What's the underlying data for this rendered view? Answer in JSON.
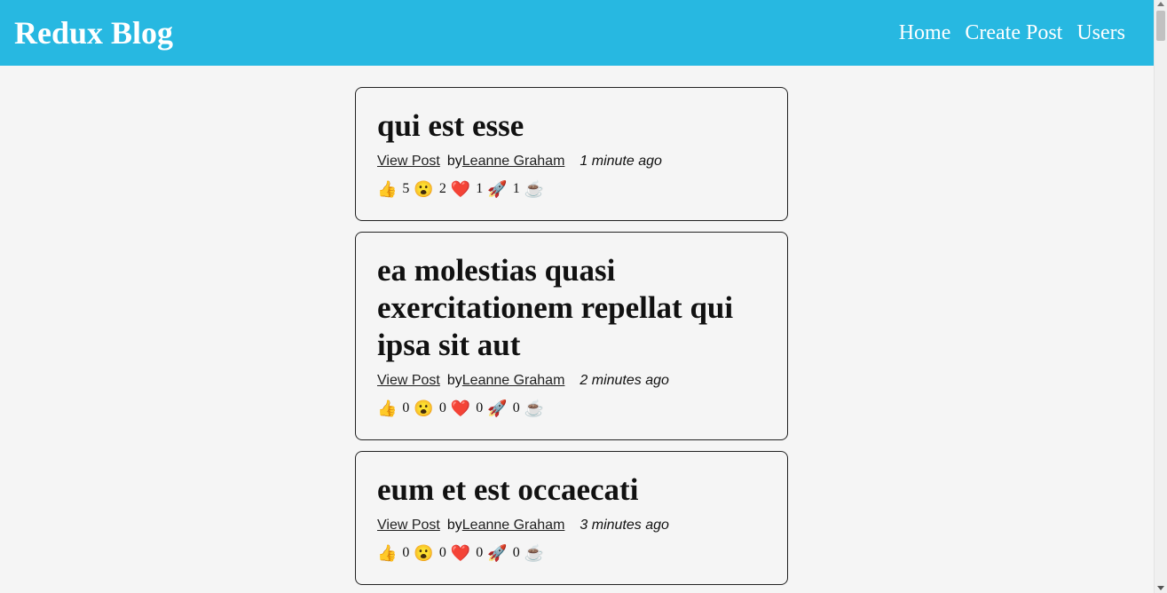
{
  "header": {
    "title": "Redux Blog",
    "nav": [
      "Home",
      "Create Post",
      "Users"
    ]
  },
  "posts": [
    {
      "title": "qui est esse",
      "view_link": "View Post",
      "by_prefix": "by",
      "author": "Leanne Graham",
      "time": "1 minute ago",
      "reactions": {
        "thumbs_up": "5",
        "wow": "2",
        "heart": "1",
        "rocket": "1",
        "coffee": ""
      }
    },
    {
      "title": "ea molestias quasi exercitationem repellat qui ipsa sit aut",
      "view_link": "View Post",
      "by_prefix": "by",
      "author": "Leanne Graham",
      "time": "2 minutes ago",
      "reactions": {
        "thumbs_up": "0",
        "wow": "0",
        "heart": "0",
        "rocket": "0",
        "coffee": ""
      }
    },
    {
      "title": "eum et est occaecati",
      "view_link": "View Post",
      "by_prefix": "by",
      "author": "Leanne Graham",
      "time": "3 minutes ago",
      "reactions": {
        "thumbs_up": "0",
        "wow": "0",
        "heart": "0",
        "rocket": "0",
        "coffee": ""
      }
    }
  ],
  "emoji": {
    "thumbs_up": "👍",
    "wow": "😮",
    "heart": "❤️",
    "rocket": "🚀",
    "coffee": "☕"
  },
  "colors": {
    "header_bg": "#27b8e1",
    "page_bg": "#f5f5f5",
    "text": "#111111"
  }
}
